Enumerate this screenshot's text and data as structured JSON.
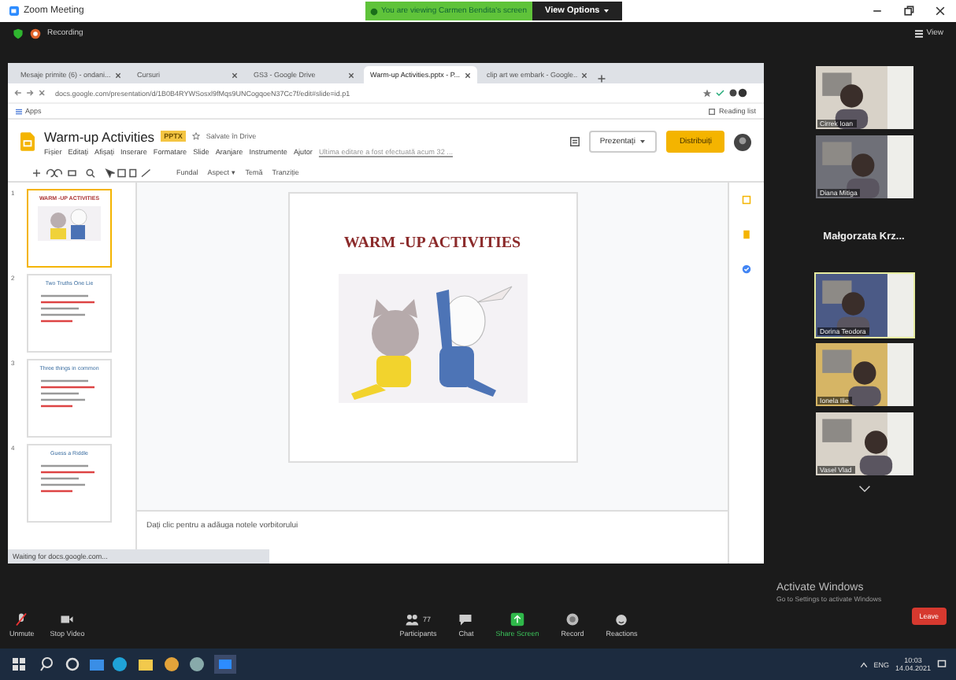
{
  "window": {
    "title": "Zoom Meeting"
  },
  "share_banner": {
    "text": "You are viewing Carmen Bendita's screen",
    "button": "View Options"
  },
  "meeting": {
    "recording": "Recording",
    "view": "View"
  },
  "browser": {
    "tabs": [
      {
        "label": "Mesaje primite (6) - ondani...",
        "selected": false
      },
      {
        "label": "Cursuri",
        "selected": false
      },
      {
        "label": "GS3 - Google Drive",
        "selected": false
      },
      {
        "label": "Warm-up Activities.pptx - P...",
        "selected": true
      },
      {
        "label": "clip art we embark - Google...",
        "selected": false
      }
    ],
    "url": "docs.google.com/presentation/d/1B0B4RYWSosxl9fMqs9UNCogqoeN37Cc7f/edit#slide=id.p1",
    "bookmark": "Apps",
    "reading_list": "Reading list",
    "status": "Waiting for docs.google.com..."
  },
  "docs": {
    "title": "Warm-up Activities",
    "badge": "PPTX",
    "saved": "Salvate în Drive",
    "menu": [
      "Fișier",
      "Editați",
      "Afișați",
      "Inserare",
      "Formatare",
      "Slide",
      "Aranjare",
      "Instrumente",
      "Ajutor"
    ],
    "last_edit": "Ultima editare a fost efectuată acum 32 ...",
    "present": "Prezentați",
    "share": "Distribuiți",
    "toolbar": [
      "Fundal",
      "Aspect ▾",
      "Temă",
      "Tranziție"
    ],
    "slides": [
      {
        "number": "1",
        "title": "WARM -UP ACTIVITIES",
        "selected": true
      },
      {
        "number": "2",
        "title": "Two Truths One Lie",
        "selected": false
      },
      {
        "number": "3",
        "title": "Three things in common",
        "selected": false
      },
      {
        "number": "4",
        "title": "Guess a Riddle",
        "selected": false
      }
    ],
    "slide_title": "WARM -UP ACTIVITIES",
    "notes": "Dați clic pentru a adăuga notele vorbitorului"
  },
  "participants": [
    {
      "name": "Cirrek Ioan",
      "kind": "video",
      "selected": false
    },
    {
      "name": "Diana Mitiga",
      "kind": "video",
      "selected": false
    },
    {
      "name": "Małgorzata  Krz...",
      "kind": "name",
      "selected": false
    },
    {
      "name": "Dorina Teodora",
      "kind": "video",
      "selected": true
    },
    {
      "name": "Ionela Ilie",
      "kind": "video",
      "selected": false
    },
    {
      "name": "Vasel Vlad",
      "kind": "video",
      "selected": false
    }
  ],
  "activate": {
    "title": "Activate Windows",
    "subtitle": "Go to Settings to activate Windows"
  },
  "controls": [
    {
      "label": "Unmute",
      "kind": "mic"
    },
    {
      "label": "Stop Video",
      "kind": "camera"
    },
    {
      "label": "Participants",
      "kind": "people",
      "count": "77"
    },
    {
      "label": "Chat",
      "kind": "chat"
    },
    {
      "label": "Share Screen",
      "kind": "share"
    },
    {
      "label": "Record",
      "kind": "record"
    },
    {
      "label": "Reactions",
      "kind": "reactions"
    }
  ],
  "leave": "Leave",
  "taskbar": {
    "language": "ENG",
    "time": "10:03",
    "date": "14.04.2021"
  }
}
